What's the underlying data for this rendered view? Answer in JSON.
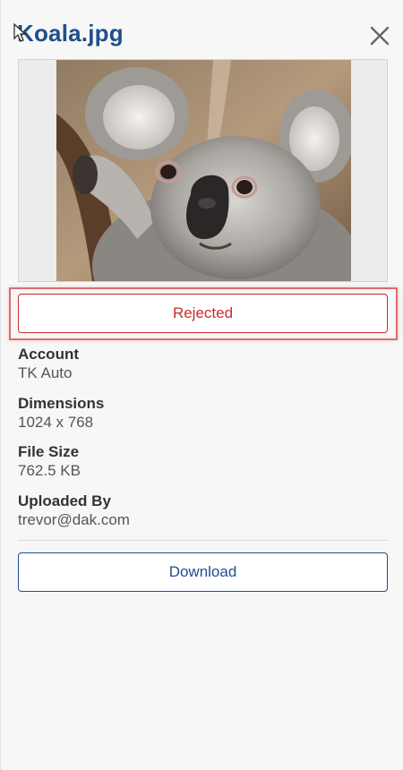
{
  "header": {
    "title": "Koala.jpg",
    "close_icon": "close-icon"
  },
  "preview": {
    "image_subject": "koala photo"
  },
  "status": {
    "label": "Rejected",
    "color": "#c92b2b"
  },
  "details": {
    "account_label": "Account",
    "account_value": "TK Auto",
    "dimensions_label": "Dimensions",
    "dimensions_value": "1024 x 768",
    "file_size_label": "File Size",
    "file_size_value": "762.5 KB",
    "uploaded_by_label": "Uploaded By",
    "uploaded_by_value": "trevor@dak.com"
  },
  "actions": {
    "download_label": "Download"
  },
  "colors": {
    "brand": "#1f4f8a",
    "rejected": "#c92b2b",
    "highlight": "#e06a6a"
  }
}
